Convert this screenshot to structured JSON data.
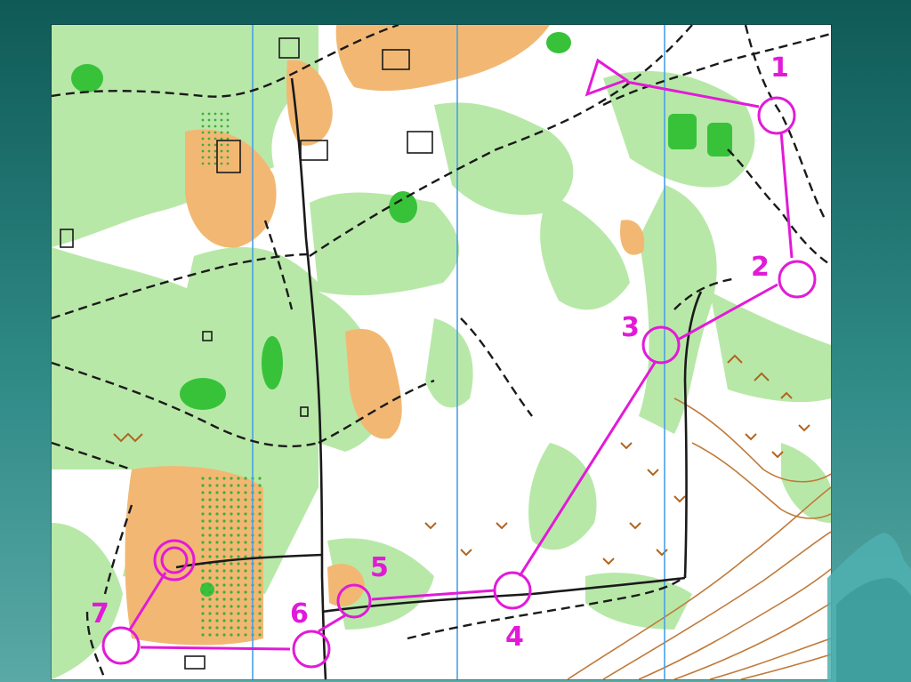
{
  "slide": {
    "background_top": "#0f5a57",
    "background_bottom": "#5aa9a6"
  },
  "map": {
    "colors": {
      "open_land": "#f2b873",
      "forest_green": "#b8e8a8",
      "dense_green": "#38c23a",
      "track": "#1a1a1a",
      "meridian": "#4aa0e8",
      "contour": "#c07a3a",
      "course": "#e21ad8"
    },
    "course": {
      "start_label": "",
      "controls": [
        {
          "number": "1"
        },
        {
          "number": "2"
        },
        {
          "number": "3"
        },
        {
          "number": "4"
        },
        {
          "number": "5"
        },
        {
          "number": "6"
        },
        {
          "number": "7"
        }
      ],
      "finish_label": ""
    }
  }
}
